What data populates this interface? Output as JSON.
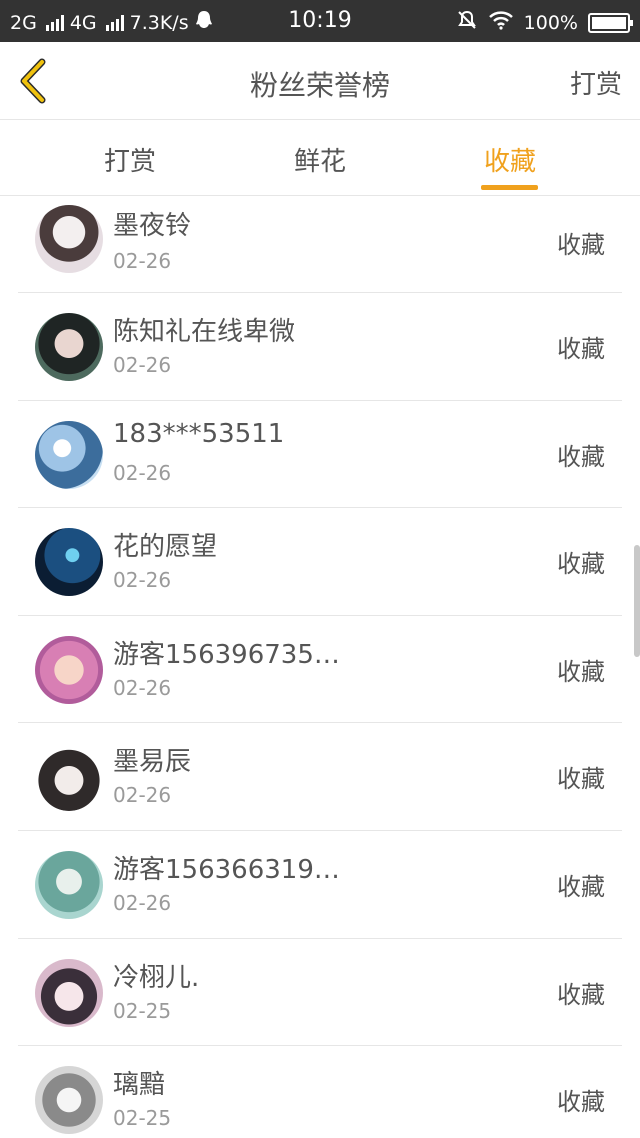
{
  "status": {
    "left": "2G",
    "net": "4G",
    "speed": "7.3K/s",
    "time": "10:19",
    "battery": "100%"
  },
  "header": {
    "title": "粉丝荣誉榜",
    "action": "打赏"
  },
  "tabs": [
    {
      "label": "打赏"
    },
    {
      "label": "鲜花"
    },
    {
      "label": "收藏"
    }
  ],
  "list": [
    {
      "name": "墨夜铃",
      "date": "02-26",
      "type": "收藏",
      "avatar_color": "#d8d0d4"
    },
    {
      "name": "陈知礼在线卑微",
      "date": "02-26",
      "type": "收藏",
      "avatar_color": "#3d4a40"
    },
    {
      "name": "183***53511",
      "date": "02-26",
      "type": "收藏",
      "avatar_color": "#8fb3d3"
    },
    {
      "name": "花的愿望",
      "date": "02-26",
      "type": "收藏",
      "avatar_color": "#1e3b5a"
    },
    {
      "name": "游客156396735…",
      "date": "02-26",
      "type": "收藏",
      "avatar_color": "#e3a6c7"
    },
    {
      "name": "墨易辰",
      "date": "02-26",
      "type": "收藏",
      "avatar_color": "#7b6c68"
    },
    {
      "name": "游客156366319…",
      "date": "02-26",
      "type": "收藏",
      "avatar_color": "#9cc7c1"
    },
    {
      "name": "冷栩儿.",
      "date": "02-25",
      "type": "收藏",
      "avatar_color": "#c7a0b6"
    },
    {
      "name": "璃黯",
      "date": "02-25",
      "type": "收藏",
      "avatar_color": "#bdbdbd"
    }
  ],
  "accent_color": "#f0a11d"
}
